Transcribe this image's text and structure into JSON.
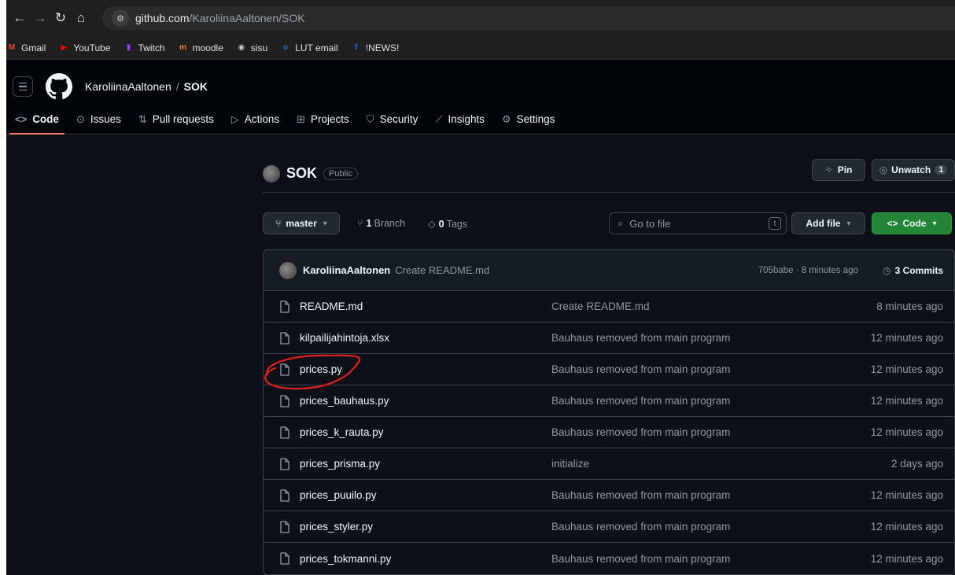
{
  "browser": {
    "url_domain": "github.com",
    "url_path": "/KaroliinaAaltonen/SOK",
    "bookmarks": [
      {
        "label": "Gmail",
        "icon": "gmail-icon",
        "color": "#ea4335",
        "glyph": "M"
      },
      {
        "label": "YouTube",
        "icon": "youtube-icon",
        "color": "#ff0000",
        "glyph": "▶"
      },
      {
        "label": "Twitch",
        "icon": "twitch-icon",
        "color": "#9146ff",
        "glyph": "▮"
      },
      {
        "label": "moodle",
        "icon": "moodle-icon",
        "color": "#f98012",
        "glyph": "m"
      },
      {
        "label": "sisu",
        "icon": "sisu-icon",
        "color": "#cccccc",
        "glyph": "◉"
      },
      {
        "label": "LUT email",
        "icon": "outlook-icon",
        "color": "#0078d4",
        "glyph": "o"
      },
      {
        "label": "!NEWS!",
        "icon": "facebook-icon",
        "color": "#1877f2",
        "glyph": "f"
      }
    ]
  },
  "header": {
    "owner": "KaroliinaAaltonen",
    "separator": "/",
    "repo": "SOK",
    "tabs": [
      {
        "label": "Code",
        "icon": "<>",
        "name": "tab-code",
        "active": true
      },
      {
        "label": "Issues",
        "icon": "⊙",
        "name": "tab-issues"
      },
      {
        "label": "Pull requests",
        "icon": "⇅",
        "name": "tab-pull-requests"
      },
      {
        "label": "Actions",
        "icon": "▷",
        "name": "tab-actions"
      },
      {
        "label": "Projects",
        "icon": "⊞",
        "name": "tab-projects"
      },
      {
        "label": "Security",
        "icon": "⛉",
        "name": "tab-security"
      },
      {
        "label": "Insights",
        "icon": "⟋",
        "name": "tab-insights"
      },
      {
        "label": "Settings",
        "icon": "⚙",
        "name": "tab-settings"
      }
    ]
  },
  "repo": {
    "name": "SOK",
    "visibility": "Public",
    "pin_label": "Pin",
    "unwatch_label": "Unwatch",
    "watch_count": "1",
    "branch": "master",
    "branch_count": "1",
    "branch_label": "Branch",
    "tag_count": "0",
    "tag_label": "Tags",
    "search_placeholder": "Go to file",
    "search_key": "t",
    "add_file_label": "Add file",
    "code_label": "Code"
  },
  "latest_commit": {
    "author": "KaroliinaAaltonen",
    "message": "Create README.md",
    "meta": "705babe · 8 minutes ago",
    "commits_count": "3",
    "commits_label": "Commits"
  },
  "files": [
    {
      "name": "README.md",
      "message": "Create README.md",
      "time": "8 minutes ago"
    },
    {
      "name": "kilpailijahintoja.xlsx",
      "message": "Bauhaus removed from main program",
      "time": "12 minutes ago"
    },
    {
      "name": "prices.py",
      "message": "Bauhaus removed from main program",
      "time": "12 minutes ago"
    },
    {
      "name": "prices_bauhaus.py",
      "message": "Bauhaus removed from main program",
      "time": "12 minutes ago"
    },
    {
      "name": "prices_k_rauta.py",
      "message": "Bauhaus removed from main program",
      "time": "12 minutes ago"
    },
    {
      "name": "prices_prisma.py",
      "message": "initialize",
      "time": "2 days ago"
    },
    {
      "name": "prices_puuilo.py",
      "message": "Bauhaus removed from main program",
      "time": "12 minutes ago"
    },
    {
      "name": "prices_styler.py",
      "message": "Bauhaus removed from main program",
      "time": "12 minutes ago"
    },
    {
      "name": "prices_tokmanni.py",
      "message": "Bauhaus removed from main program",
      "time": "12 minutes ago"
    }
  ],
  "colors": {
    "background": "#0d1117",
    "header": "#010409",
    "accent_tab": "#f78166",
    "code_button": "#238636",
    "annotation": "#e02020"
  }
}
